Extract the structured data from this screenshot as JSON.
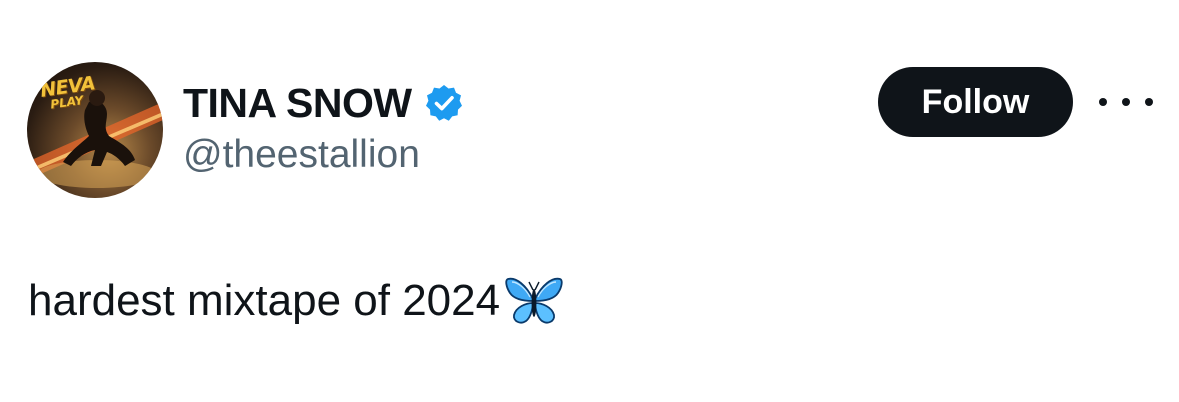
{
  "author": {
    "display_name": "TINA SNOW",
    "handle": "@theestallion",
    "verified": true,
    "avatar_logo_line1": "NEVA",
    "avatar_logo_line2": "PLAY"
  },
  "actions": {
    "follow_label": "Follow",
    "more_icon": "more-horizontal-icon"
  },
  "tweet": {
    "text": "hardest mixtape of 2024",
    "emoji_icon": "butterfly-icon"
  },
  "colors": {
    "text_primary": "#0f1419",
    "text_secondary": "#536471",
    "verified_badge": "#1d9bf0",
    "follow_bg": "#0f1419",
    "follow_text": "#ffffff",
    "butterfly": "#4ab3f4"
  }
}
